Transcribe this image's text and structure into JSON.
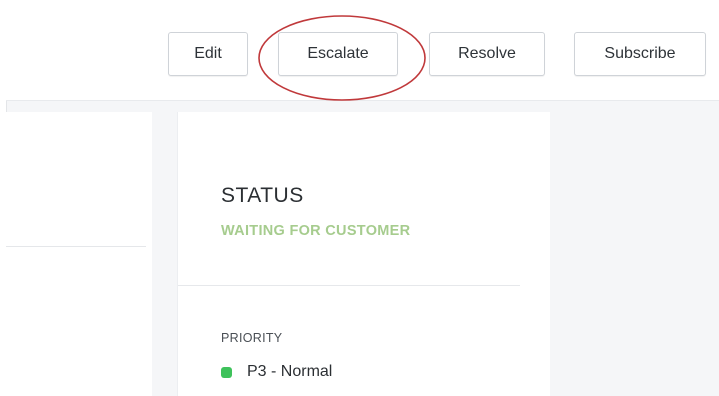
{
  "toolbar": {
    "edit_label": "Edit",
    "escalate_label": "Escalate",
    "resolve_label": "Resolve",
    "subscribe_label": "Subscribe"
  },
  "status": {
    "label": "STATUS",
    "value": "WAITING FOR CUSTOMER",
    "value_color": "#a6cc8e"
  },
  "priority": {
    "label": "PRIORITY",
    "value": "P3 - Normal",
    "indicator_color": "#3ec25b"
  },
  "annotation": {
    "highlight_color": "#c0393b"
  }
}
